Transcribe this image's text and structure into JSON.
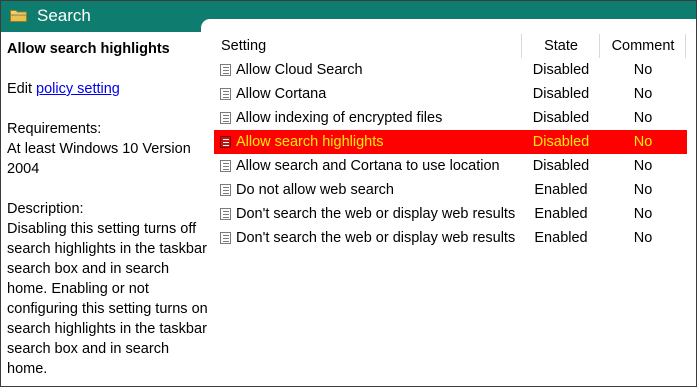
{
  "window": {
    "title": "Search",
    "accent": "#0e7c6f",
    "folder_icon": "folder-icon"
  },
  "detail": {
    "heading": "Allow search highlights",
    "edit_prefix": "Edit",
    "edit_link": "policy setting",
    "requirements_label": "Requirements:",
    "requirements_text": "At least Windows 10 Version 2004",
    "description_label": "Description:",
    "description_text": "Disabling this setting turns off search highlights in the taskbar search box and in search home. Enabling or not configuring this setting turns on search highlights in the taskbar search box and in search home."
  },
  "table": {
    "columns": [
      "Setting",
      "State",
      "Comment"
    ],
    "rows": [
      {
        "setting": "Allow Cloud Search",
        "state": "Disabled",
        "comment": "No"
      },
      {
        "setting": "Allow Cortana",
        "state": "Disabled",
        "comment": "No"
      },
      {
        "setting": "Allow indexing of encrypted files",
        "state": "Disabled",
        "comment": "No"
      },
      {
        "setting": "Allow search highlights",
        "state": "Disabled",
        "comment": "No",
        "selected": true
      },
      {
        "setting": "Allow search and Cortana to use location",
        "state": "Disabled",
        "comment": "No"
      },
      {
        "setting": "Do not allow web search",
        "state": "Enabled",
        "comment": "No"
      },
      {
        "setting": "Don't search the web or display web results",
        "state": "Enabled",
        "comment": "No"
      },
      {
        "setting": "Don't search the web or display web results",
        "state": "Enabled",
        "comment": "No"
      }
    ]
  },
  "colors": {
    "selected_bg": "#fe0000",
    "selected_text": "#ffee00",
    "link": "#0000ee"
  }
}
